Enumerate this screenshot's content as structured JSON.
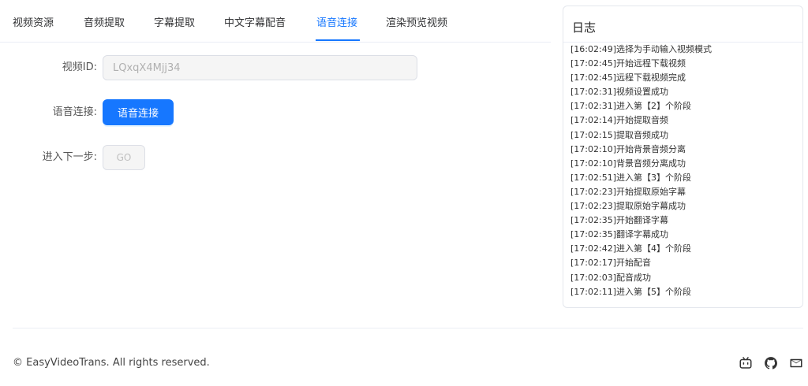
{
  "tabs": [
    {
      "label": "视频资源",
      "active": false
    },
    {
      "label": "音频提取",
      "active": false
    },
    {
      "label": "字幕提取",
      "active": false
    },
    {
      "label": "中文字幕配音",
      "active": false
    },
    {
      "label": "语音连接",
      "active": true
    },
    {
      "label": "渲染预览视频",
      "active": false
    }
  ],
  "form": {
    "video_id_label": "视频ID:",
    "video_id_value": "LQxqX4Mjj34",
    "voice_connect_label": "语音连接:",
    "voice_connect_button": "语音连接",
    "next_step_label": "进入下一步:",
    "go_button": "GO"
  },
  "log": {
    "title": "日志",
    "entries": [
      "[16:02:49]选择为手动输入视频模式",
      "[17:02:45]开始远程下载视频",
      "[17:02:45]远程下载视频完成",
      "[17:02:31]视频设置成功",
      "[17:02:31]进入第【2】个阶段",
      "[17:02:14]开始提取音频",
      "[17:02:15]提取音频成功",
      "[17:02:10]开始背景音频分离",
      "[17:02:10]背景音频分离成功",
      "[17:02:51]进入第【3】个阶段",
      "[17:02:23]开始提取原始字幕",
      "[17:02:23]提取原始字幕成功",
      "[17:02:35]开始翻译字幕",
      "[17:02:35]翻译字幕成功",
      "[17:02:42]进入第【4】个阶段",
      "[17:02:17]开始配音",
      "[17:02:03]配音成功",
      "[17:02:11]进入第【5】个阶段"
    ]
  },
  "footer": {
    "copyright": "© EasyVideoTrans. All rights reserved.",
    "icons": [
      "bilibili-icon",
      "github-icon",
      "mail-icon"
    ]
  },
  "colors": {
    "accent": "#1677ff",
    "border": "#dcdfe6",
    "disabled_bg": "#f5f5f5"
  }
}
